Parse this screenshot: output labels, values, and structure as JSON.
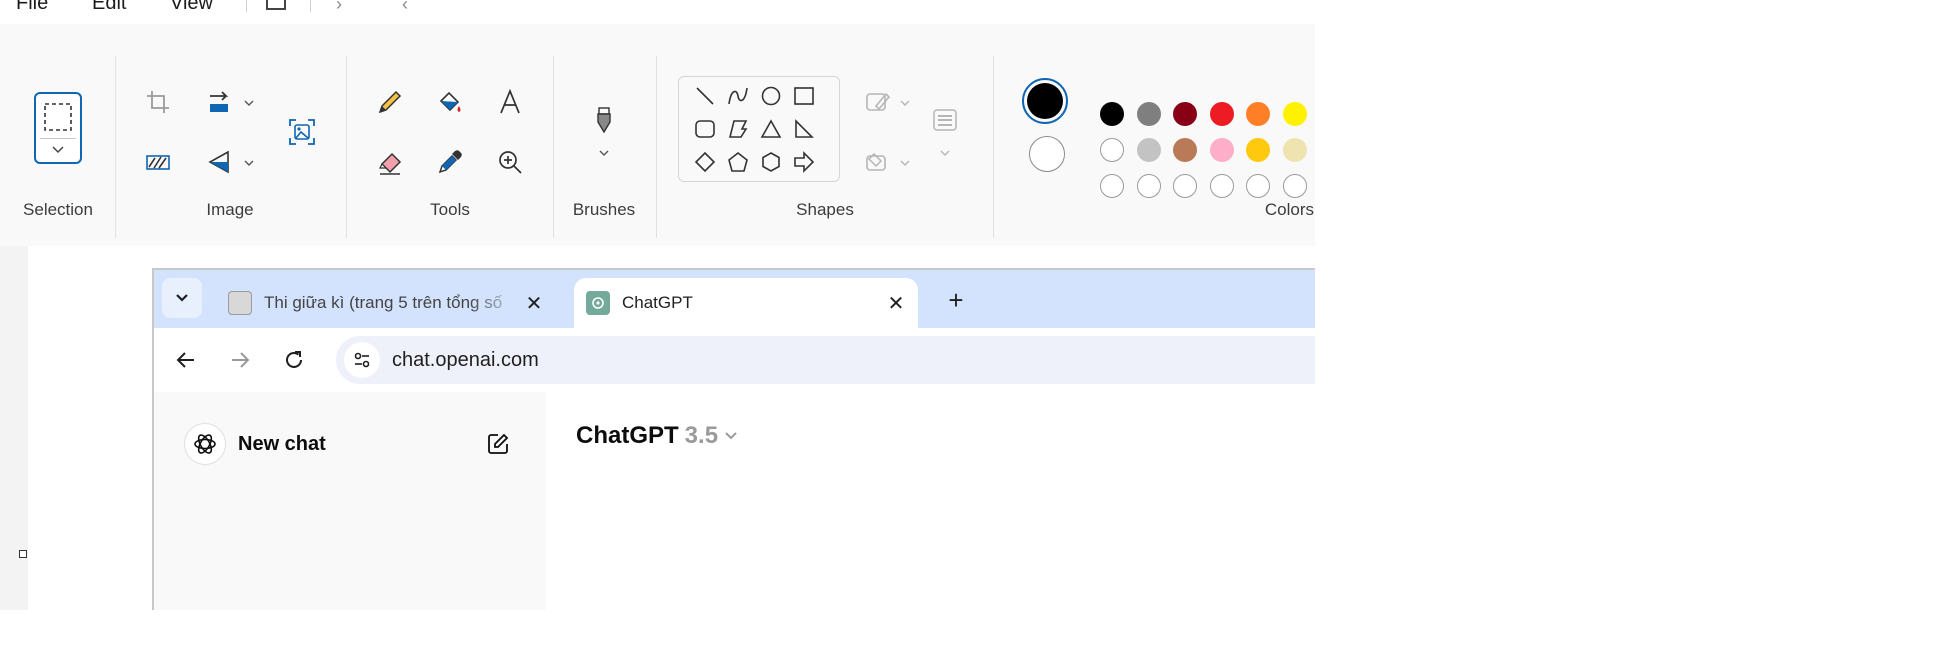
{
  "menu": {
    "file": "File",
    "edit": "Edit",
    "view": "View"
  },
  "ribbon": {
    "groups": {
      "selection": "Selection",
      "image": "Image",
      "tools": "Tools",
      "brushes": "Brushes",
      "shapes": "Shapes",
      "colors": "Colors"
    }
  },
  "colors": {
    "primary": "#000000",
    "secondary": "#ffffff",
    "accent": "#1066b3",
    "palette_row1": [
      "#000000",
      "#7f7f7f",
      "#880015",
      "#ed1c24",
      "#ff7f27",
      "#fff200"
    ],
    "palette_row2": [
      "#ffffff",
      "#c3c3c3",
      "#b97a57",
      "#ffaec9",
      "#ffc90e",
      "#efe4b0"
    ],
    "palette_row3": [
      "custom-empty",
      "custom-empty",
      "custom-empty",
      "custom-empty",
      "custom-empty",
      "custom-empty"
    ]
  },
  "browser": {
    "tabs": [
      {
        "title": "Thi giữa kì (trang 5 trên tổng số",
        "icon": "quiz-favicon",
        "active": false
      },
      {
        "title": "ChatGPT",
        "icon": "chatgpt-favicon",
        "active": true
      }
    ],
    "url": "chat.openai.com",
    "tabbar_color": "#d3e3fd"
  },
  "chatgpt": {
    "new_chat": "New chat",
    "model_name": "ChatGPT",
    "model_version": "3.5"
  }
}
